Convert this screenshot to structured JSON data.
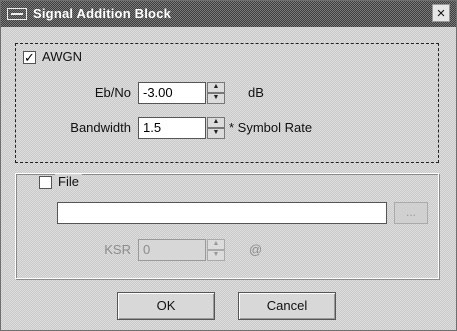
{
  "window": {
    "title": "Signal Addition Block",
    "close_symbol": "×"
  },
  "awgn": {
    "checkbox_label": "AWGN",
    "checked": true,
    "ebno_label": "Eb/No",
    "ebno_value": "-3.00",
    "ebno_unit": "dB",
    "bandwidth_label": "Bandwidth",
    "bandwidth_value": "1.5",
    "bandwidth_unit": "* Symbol Rate"
  },
  "file": {
    "checkbox_label": "File",
    "checked": false,
    "path_value": "",
    "browse_label": "...",
    "ksr_label": "KSR",
    "ksr_value": "0",
    "ksr_unit": "@"
  },
  "buttons": {
    "ok_label": "OK",
    "cancel_label": "Cancel"
  },
  "icons": {
    "spin_up": "▲",
    "spin_down": "▼",
    "check": "✓"
  }
}
